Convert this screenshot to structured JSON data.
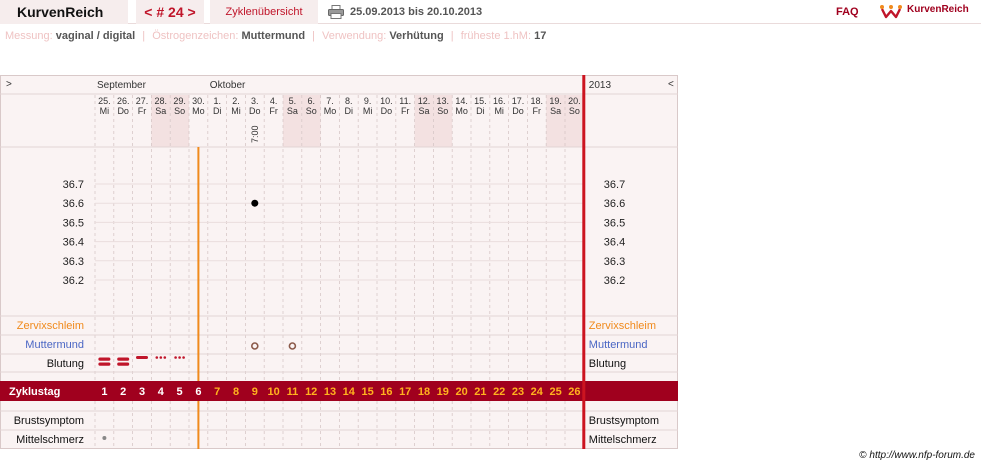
{
  "header": {
    "app_title": "KurvenReich",
    "cycle_nav": "< # 24 >",
    "overview_label": "Zyklenübersicht",
    "date_range": "25.09.2013 bis 20.10.2013",
    "faq_label": "FAQ",
    "logo_text": "KurvenReich",
    "icons": {
      "print": "printer-icon",
      "logo": "crown-logo-icon"
    }
  },
  "meta": [
    {
      "label": "Messung:",
      "value": "vaginal / digital"
    },
    {
      "label": "Östrogenzeichen:",
      "value": "Muttermund"
    },
    {
      "label": "Verwendung:",
      "value": "Verhütung"
    },
    {
      "label": "früheste 1.hM:",
      "value": "17"
    }
  ],
  "chart_data": {
    "type": "scatter",
    "nav": {
      "prev": ">",
      "next": "<"
    },
    "year": "2013",
    "months": [
      {
        "label": "September",
        "start_day": 0
      },
      {
        "label": "Oktober",
        "start_day": 6
      }
    ],
    "days": [
      {
        "date": "25.",
        "wd": "Mi",
        "weekend": false
      },
      {
        "date": "26.",
        "wd": "Do",
        "weekend": false
      },
      {
        "date": "27.",
        "wd": "Fr",
        "weekend": false
      },
      {
        "date": "28.",
        "wd": "Sa",
        "weekend": true
      },
      {
        "date": "29.",
        "wd": "So",
        "weekend": true
      },
      {
        "date": "30.",
        "wd": "Mo",
        "weekend": false
      },
      {
        "date": "1.",
        "wd": "Di",
        "weekend": false
      },
      {
        "date": "2.",
        "wd": "Mi",
        "weekend": false
      },
      {
        "date": "3.",
        "wd": "Do",
        "weekend": false
      },
      {
        "date": "4.",
        "wd": "Fr",
        "weekend": false
      },
      {
        "date": "5.",
        "wd": "Sa",
        "weekend": true
      },
      {
        "date": "6.",
        "wd": "So",
        "weekend": true
      },
      {
        "date": "7.",
        "wd": "Mo",
        "weekend": false
      },
      {
        "date": "8.",
        "wd": "Di",
        "weekend": false
      },
      {
        "date": "9.",
        "wd": "Mi",
        "weekend": false
      },
      {
        "date": "10.",
        "wd": "Do",
        "weekend": false
      },
      {
        "date": "11.",
        "wd": "Fr",
        "weekend": false
      },
      {
        "date": "12.",
        "wd": "Sa",
        "weekend": true
      },
      {
        "date": "13.",
        "wd": "So",
        "weekend": true
      },
      {
        "date": "14.",
        "wd": "Mo",
        "weekend": false
      },
      {
        "date": "15.",
        "wd": "Di",
        "weekend": false
      },
      {
        "date": "16.",
        "wd": "Mi",
        "weekend": false
      },
      {
        "date": "17.",
        "wd": "Do",
        "weekend": false
      },
      {
        "date": "18.",
        "wd": "Fr",
        "weekend": false
      },
      {
        "date": "19.",
        "wd": "Sa",
        "weekend": true
      },
      {
        "date": "20.",
        "wd": "So",
        "weekend": true
      }
    ],
    "time_labels": [
      {
        "day": 8,
        "text": "7:00"
      }
    ],
    "y_ticks": [
      "36.7",
      "36.6",
      "36.5",
      "36.4",
      "36.3",
      "36.2"
    ],
    "temperatures": [
      {
        "day": 8,
        "value": 36.6
      }
    ],
    "cover_line_after_day": 5,
    "rows": {
      "cervix": "Zervixschleim",
      "os": "Muttermund",
      "bleeding": "Blutung",
      "cycle_day": "Zyklustag",
      "breast": "Brustsymptom",
      "mittelschmerz": "Mittelschmerz"
    },
    "cycle_day_numbers": [
      "1",
      "2",
      "3",
      "4",
      "5",
      "6",
      "7",
      "8",
      "9",
      "10",
      "11",
      "12",
      "13",
      "14",
      "15",
      "16",
      "17",
      "18",
      "19",
      "20",
      "21",
      "22",
      "23",
      "24",
      "25",
      "26"
    ],
    "bleeding": [
      {
        "day": 0,
        "level": "strong"
      },
      {
        "day": 1,
        "level": "strong"
      },
      {
        "day": 2,
        "level": "medium"
      },
      {
        "day": 3,
        "level": "light"
      },
      {
        "day": 4,
        "level": "light"
      }
    ],
    "os_marks": [
      {
        "day": 8
      },
      {
        "day": 10
      }
    ],
    "mittelschmerz_marks": [
      {
        "day": 0
      }
    ],
    "colors": {
      "accent": "#a0001e",
      "cover_line": "#f08a1c",
      "weekend": "#f3e1e1",
      "cervix_label": "#f08a1c",
      "os_label": "#4a66c4"
    }
  },
  "footer": {
    "credit": "http://www.nfp-forum.de",
    "credit_symbol": "©"
  }
}
